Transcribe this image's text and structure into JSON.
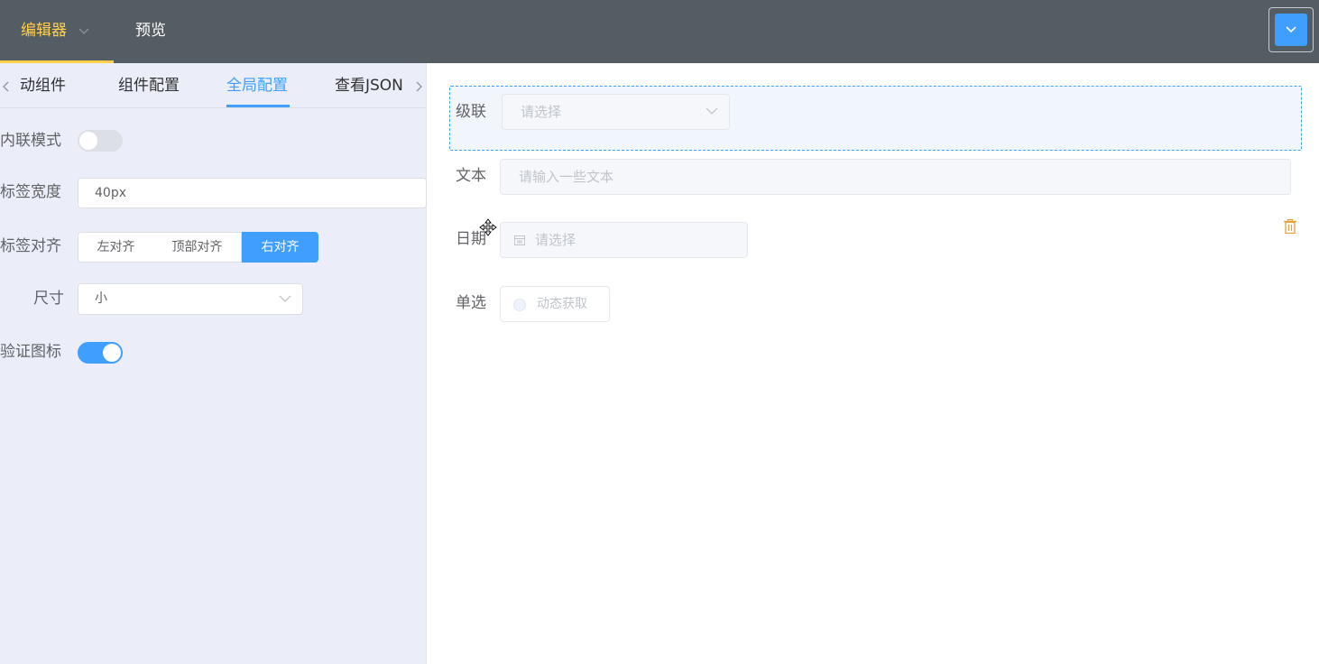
{
  "topbar": {
    "editor_label": "编辑器",
    "preview_label": "预览",
    "accent_color": "#ffd04b",
    "bg_color": "#545c64"
  },
  "tabs": {
    "items": [
      "动组件",
      "组件配置",
      "全局配置",
      "查看JSON"
    ],
    "active_index": 2
  },
  "global_config": {
    "inline_mode_label": "内联模式",
    "inline_mode_on": false,
    "label_width_label": "标签宽度",
    "label_width_value": "40px",
    "label_align_label": "标签对齐",
    "align_options": [
      "左对齐",
      "顶部对齐",
      "右对齐"
    ],
    "align_selected": "右对齐",
    "size_label": "尺寸",
    "size_value": "小",
    "validate_icon_label": "验证图标",
    "validate_icon_on": true
  },
  "canvas": {
    "cascader_label": "级联",
    "cascader_placeholder": "请选择",
    "text_label": "文本",
    "text_placeholder": "请输入一些文本",
    "date_label": "日期",
    "date_placeholder": "请选择",
    "radio_label": "单选",
    "radio_option": "动态获取"
  },
  "colors": {
    "primary": "#409eff",
    "danger_icon": "#e6a23c"
  }
}
